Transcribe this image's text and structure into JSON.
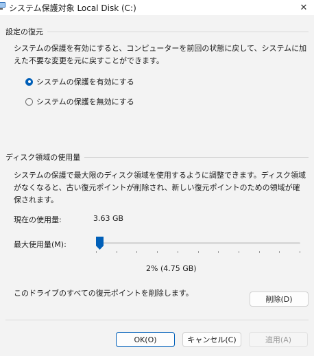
{
  "window": {
    "title": "システム保護対象 Local Disk (C:)",
    "close_glyph": "✕"
  },
  "restore_settings": {
    "header": "設定の復元",
    "description": "システムの保護を有効にすると、コンピューターを前回の状態に戻して、システムに加えた不要な変更を元に戻すことができます。",
    "options": [
      {
        "label": "システムの保護を有効にする",
        "selected": true
      },
      {
        "label": "システムの保護を無効にする",
        "selected": false
      }
    ]
  },
  "disk_usage": {
    "header": "ディスク領域の使用量",
    "description": "システムの保護で最大限のディスク領域を使用するように調整できます。ディスク領域がなくなると、古い復元ポイントが削除され、新しい復元ポイントのための領域が確保されます。",
    "current_label": "現在の使用量:",
    "current_value": "3.63 GB",
    "max_label": "最大使用量(M):",
    "max_percent": 2,
    "max_value_text": "2% (4.75 GB)",
    "delete_text": "このドライブのすべての復元ポイントを削除します。",
    "delete_button": "削除(D)"
  },
  "footer": {
    "ok": "OK(O)",
    "cancel": "キャンセル(C)",
    "apply": "適用(A)"
  },
  "colors": {
    "accent": "#005fb8"
  }
}
